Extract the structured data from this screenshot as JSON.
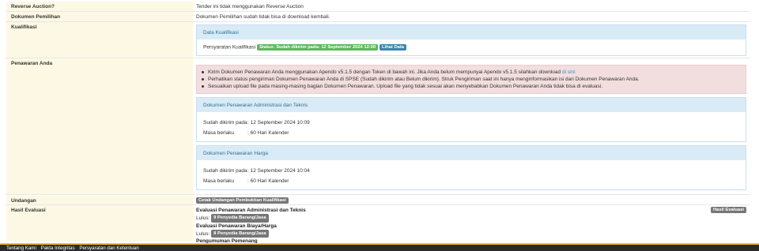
{
  "rows": {
    "reverse_auction": {
      "label": "Reverse Auction?",
      "value": "Tender ini tidak menggunakan Reverse Auction"
    },
    "dokumen_pemilihan": {
      "label": "Dokumen Pemilihan",
      "value": "Dokumen Pemilihan sudah tidak bisa di download kembali."
    },
    "kualifikasi": {
      "label": "Kualifikasi",
      "panel_title": "Data Kualifikasi",
      "persyaratan_label": "Persyaratan Kualifikasi",
      "status_badge": "Status: Sudah dikirim pada: 12 September 2024 12:00",
      "lihat_data": "Lihat Data"
    },
    "penawaran": {
      "label": "Penawaran Anda",
      "alerts": [
        "Kirim Dokumen Penawaran Anda menggunakan Apendo v5.1.5 dengan Token di bawah ini. Jika Anda belum mempunyai Apendo v5.1.5 silahkan download ",
        "Perhatikan status pengiriman Dokumen Penawaran Anda di SPSE (Sudah dikirim atau Belum dikirim). Struk Pengiriman saat ini hanya menginformasikan isi dari Dokumen Penawaran Anda.",
        "Sesuaikan upload file pada masing-masing bagian Dokumen Penawaran. Upload file yang tidak sesuai akan menyebabkan Dokumen Penawaran Anda tidak bisa di evaluasi."
      ],
      "download_link": "di sini",
      "admin_panel": {
        "title": "Dokumen Penawaran Administrasi dan Teknis",
        "sent_label": "Sudah dikirim pada",
        "sent_value": ": 12 September 2024 10:09",
        "valid_label": "Masa berlaku",
        "valid_value": ": 60 Hari Kalender"
      },
      "price_panel": {
        "title": "Dokumen Penawaran Harga",
        "sent_label": "Sudah dikirim pada",
        "sent_value": ": 12 September 2024 10:04",
        "valid_label": "Masa berlaku",
        "valid_value": ": 60 Hari Kalender"
      }
    },
    "undangan": {
      "label": "Undangan",
      "button": "Cetak Undangan Pembuktian Kualifikasi"
    },
    "hasil_evaluasi": {
      "label": "Hasil Evaluasi",
      "button": "Hasil Evaluasi",
      "admin_title": "Evaluasi Penawaran Administrasi dan Teknis",
      "lulus_label": "Lulus:",
      "admin_badge": "9 Penyedia Barang/Jasa",
      "price_title": "Evaluasi Penawaran Biaya/Harga",
      "price_badge": "8 Penyedia Barang/Jasa",
      "winner_title": "Pengumuman Pemenang"
    }
  },
  "footer": {
    "links": [
      "Tentang Kami",
      "Pakta Integritas",
      "Persyaratan dan Ketentuan"
    ]
  },
  "colors": {
    "label_bg": "#fdf8e4",
    "panel_head": "#d9ebf7",
    "alert_bg": "#f2dede",
    "footer_bg": "#2b2b2b",
    "footer_accent": "#f5c518"
  }
}
